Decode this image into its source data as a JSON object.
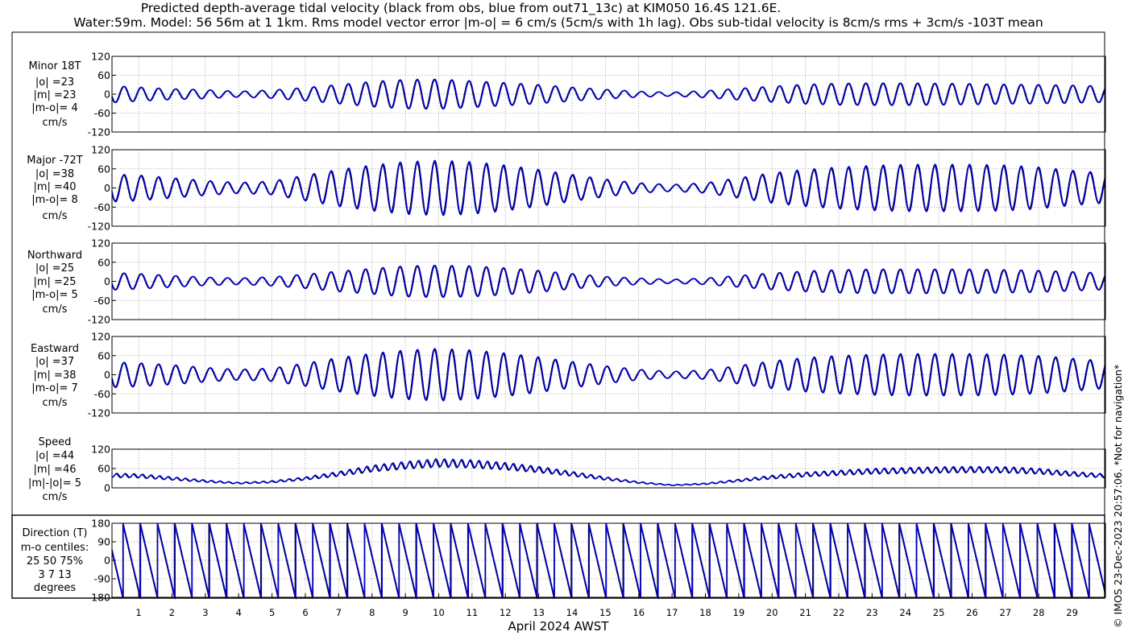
{
  "title": {
    "line1": "Predicted depth-average tidal velocity (black from obs, blue from out71_13c) at KIM050 16.4S 121.6E.",
    "line2": "Water:59m. Model: 56 56m at 1 1km. Rms model vector error |m-o| = 6 cm/s (5cm/s with 1h lag). Obs sub-tidal velocity is 8cm/s rms + 3cm/s -103T mean"
  },
  "side_note": "© IMOS 23-Dec-2023 20:57:06. *Not for navigation*",
  "colors": {
    "obs": "#000000",
    "model": "#0000cc",
    "grid": "#9a9a9a"
  },
  "chart_data": [
    {
      "type": "line",
      "panel": "minor",
      "labels": [
        "Minor 18T",
        "|o| =23",
        "|m| =23",
        "|m-o|= 4",
        "cm/s"
      ],
      "yticks": [
        "120",
        "60",
        "0",
        "-60",
        "-120"
      ],
      "ytick_values": [
        120,
        60,
        0,
        -60,
        -120
      ],
      "ylim": [
        -120,
        120
      ],
      "x": {
        "start_day": 0.2,
        "end_day": 30.0
      },
      "grid": true,
      "model": {
        "amp": 23,
        "lag_days": 0.02
      },
      "series": [
        {
          "role": "obs",
          "color": "#000000",
          "envelope": [
            [
              0,
              28
            ],
            [
              1,
              22
            ],
            [
              2,
              17
            ],
            [
              3,
              14
            ],
            [
              4,
              9
            ],
            [
              5,
              13
            ],
            [
              6,
              21
            ],
            [
              7,
              30
            ],
            [
              8,
              40
            ],
            [
              9,
              46
            ],
            [
              10,
              47
            ],
            [
              11,
              42
            ],
            [
              12,
              36
            ],
            [
              13,
              30
            ],
            [
              14,
              22
            ],
            [
              15,
              15
            ],
            [
              16,
              9
            ],
            [
              17,
              6
            ],
            [
              18,
              11
            ],
            [
              19,
              18
            ],
            [
              20,
              25
            ],
            [
              21,
              31
            ],
            [
              22,
              34
            ],
            [
              23,
              35
            ],
            [
              24,
              35
            ],
            [
              25,
              34
            ],
            [
              26,
              33
            ],
            [
              27,
              31
            ],
            [
              28,
              30
            ],
            [
              29,
              28
            ],
            [
              30,
              26
            ]
          ]
        }
      ]
    },
    {
      "type": "line",
      "panel": "major",
      "labels": [
        "Major -72T",
        "|o| =38",
        "|m| =40",
        "|m-o|= 8",
        "cm/s"
      ],
      "yticks": [
        "120",
        "60",
        "0",
        "-60",
        "-120"
      ],
      "ytick_values": [
        120,
        60,
        0,
        -60,
        -120
      ],
      "ylim": [
        -120,
        120
      ],
      "x": {
        "start_day": 0.2,
        "end_day": 30.0
      },
      "grid": true,
      "model": {
        "amp": 40,
        "lag_days": 0.02
      },
      "series": [
        {
          "role": "obs",
          "color": "#000000",
          "envelope": [
            [
              0,
              42
            ],
            [
              1,
              38
            ],
            [
              2,
              30
            ],
            [
              3,
              22
            ],
            [
              4,
              16
            ],
            [
              5,
              20
            ],
            [
              6,
              38
            ],
            [
              7,
              55
            ],
            [
              8,
              68
            ],
            [
              9,
              78
            ],
            [
              10,
              82
            ],
            [
              11,
              78
            ],
            [
              12,
              68
            ],
            [
              13,
              55
            ],
            [
              14,
              40
            ],
            [
              15,
              26
            ],
            [
              16,
              15
            ],
            [
              17,
              10
            ],
            [
              18,
              15
            ],
            [
              19,
              30
            ],
            [
              20,
              45
            ],
            [
              21,
              55
            ],
            [
              22,
              62
            ],
            [
              23,
              67
            ],
            [
              24,
              70
            ],
            [
              25,
              70
            ],
            [
              26,
              70
            ],
            [
              27,
              68
            ],
            [
              28,
              62
            ],
            [
              29,
              52
            ],
            [
              30,
              45
            ]
          ]
        }
      ]
    },
    {
      "type": "line",
      "panel": "northward",
      "labels": [
        "Northward",
        "|o| =25",
        "|m| =25",
        "|m-o|= 5",
        "cm/s"
      ],
      "yticks": [
        "120",
        "60",
        "0",
        "-60",
        "-120"
      ],
      "ytick_values": [
        120,
        60,
        0,
        -60,
        -120
      ],
      "ylim": [
        -120,
        120
      ],
      "x": {
        "start_day": 0.2,
        "end_day": 30.0
      },
      "grid": true,
      "model": {
        "amp": 25,
        "lag_days": 0.02
      },
      "series": [
        {
          "role": "obs",
          "color": "#000000",
          "envelope": [
            [
              0,
              28
            ],
            [
              1,
              24
            ],
            [
              2,
              18
            ],
            [
              3,
              13
            ],
            [
              4,
              10
            ],
            [
              5,
              14
            ],
            [
              6,
              22
            ],
            [
              7,
              32
            ],
            [
              8,
              40
            ],
            [
              9,
              48
            ],
            [
              10,
              50
            ],
            [
              11,
              48
            ],
            [
              12,
              42
            ],
            [
              13,
              34
            ],
            [
              14,
              24
            ],
            [
              15,
              15
            ],
            [
              16,
              10
            ],
            [
              17,
              6
            ],
            [
              18,
              10
            ],
            [
              19,
              18
            ],
            [
              20,
              26
            ],
            [
              21,
              32
            ],
            [
              22,
              36
            ],
            [
              23,
              38
            ],
            [
              24,
              38
            ],
            [
              25,
              38
            ],
            [
              26,
              38
            ],
            [
              27,
              36
            ],
            [
              28,
              34
            ],
            [
              29,
              30
            ],
            [
              30,
              26
            ]
          ]
        }
      ]
    },
    {
      "type": "line",
      "panel": "eastward",
      "labels": [
        "Eastward",
        "|o| =37",
        "|m| =38",
        "|m-o|= 7",
        "cm/s"
      ],
      "yticks": [
        "120",
        "60",
        "0",
        "-60",
        "-120"
      ],
      "ytick_values": [
        120,
        60,
        0,
        -60,
        -120
      ],
      "ylim": [
        -120,
        120
      ],
      "x": {
        "start_day": 0.2,
        "end_day": 30.0
      },
      "grid": true,
      "model": {
        "amp": 38,
        "lag_days": 0.02
      },
      "series": [
        {
          "role": "obs",
          "color": "#000000",
          "envelope": [
            [
              0,
              40
            ],
            [
              1,
              36
            ],
            [
              2,
              30
            ],
            [
              3,
              22
            ],
            [
              4,
              16
            ],
            [
              5,
              20
            ],
            [
              6,
              35
            ],
            [
              7,
              52
            ],
            [
              8,
              65
            ],
            [
              9,
              75
            ],
            [
              10,
              80
            ],
            [
              11,
              75
            ],
            [
              12,
              66
            ],
            [
              13,
              54
            ],
            [
              14,
              40
            ],
            [
              15,
              27
            ],
            [
              16,
              16
            ],
            [
              17,
              10
            ],
            [
              18,
              14
            ],
            [
              19,
              28
            ],
            [
              20,
              42
            ],
            [
              21,
              52
            ],
            [
              22,
              58
            ],
            [
              23,
              62
            ],
            [
              24,
              64
            ],
            [
              25,
              64
            ],
            [
              26,
              64
            ],
            [
              27,
              62
            ],
            [
              28,
              58
            ],
            [
              29,
              50
            ],
            [
              30,
              42
            ]
          ]
        }
      ]
    },
    {
      "type": "line",
      "panel": "speed",
      "labels": [
        "Speed",
        "|o| =44",
        "|m| =46",
        "|m|-|o|= 5",
        "cm/s"
      ],
      "yticks": [
        "120",
        "60",
        "0"
      ],
      "ytick_values": [
        120,
        60,
        0
      ],
      "ylim": [
        0,
        120
      ],
      "x": {
        "start_day": 0.2,
        "end_day": 30.0
      },
      "grid": true,
      "model": {
        "amp": 46,
        "lag_days": 0.02
      },
      "series": [
        {
          "role": "obs",
          "color": "#000000",
          "mean": [
            [
              0,
              38
            ],
            [
              1,
              36
            ],
            [
              2,
              28
            ],
            [
              3,
              20
            ],
            [
              4,
              14
            ],
            [
              5,
              18
            ],
            [
              6,
              28
            ],
            [
              7,
              42
            ],
            [
              8,
              58
            ],
            [
              9,
              68
            ],
            [
              10,
              75
            ],
            [
              11,
              72
            ],
            [
              12,
              65
            ],
            [
              13,
              55
            ],
            [
              14,
              42
            ],
            [
              15,
              28
            ],
            [
              16,
              16
            ],
            [
              17,
              8
            ],
            [
              18,
              12
            ],
            [
              19,
              22
            ],
            [
              20,
              32
            ],
            [
              21,
              40
            ],
            [
              22,
              45
            ],
            [
              23,
              50
            ],
            [
              24,
              52
            ],
            [
              25,
              54
            ],
            [
              26,
              55
            ],
            [
              27,
              54
            ],
            [
              28,
              50
            ],
            [
              29,
              42
            ],
            [
              30,
              36
            ]
          ],
          "ripple": 0.15
        }
      ]
    },
    {
      "type": "line",
      "panel": "direction",
      "labels": [
        "Direction (T)",
        "m-o centiles:",
        "25  50  75%",
        "3   7  13",
        "degrees"
      ],
      "yticks": [
        "180",
        "90",
        "0",
        "-90",
        "-180"
      ],
      "ytick_values": [
        180,
        90,
        0,
        -90,
        -180
      ],
      "ylim": [
        -180,
        180
      ],
      "x": {
        "start_day": 0.2,
        "end_day": 30.0
      },
      "grid": true,
      "series": [
        {
          "role": "obs",
          "color": "#000000"
        },
        {
          "role": "model",
          "color": "#0000cc"
        }
      ]
    }
  ],
  "xaxis": {
    "ticks": [
      "1",
      "2",
      "3",
      "4",
      "5",
      "6",
      "7",
      "8",
      "9",
      "10",
      "11",
      "12",
      "13",
      "14",
      "15",
      "16",
      "17",
      "18",
      "19",
      "20",
      "21",
      "22",
      "23",
      "24",
      "25",
      "26",
      "27",
      "28",
      "29"
    ],
    "tick_days": [
      1,
      2,
      3,
      4,
      5,
      6,
      7,
      8,
      9,
      10,
      11,
      12,
      13,
      14,
      15,
      16,
      17,
      18,
      19,
      20,
      21,
      22,
      23,
      24,
      25,
      26,
      27,
      28,
      29
    ],
    "label": "April 2024 AWST",
    "period_days": 0.5175
  }
}
